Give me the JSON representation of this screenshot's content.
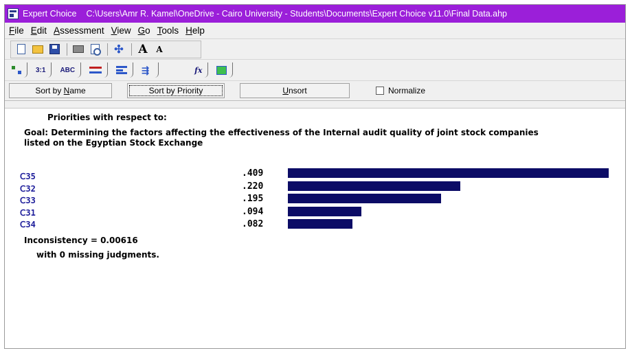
{
  "window": {
    "app_name": "Expert Choice",
    "path": "C:\\Users\\Amr R. Kamel\\OneDrive - Cairo University - Students\\Documents\\Expert Choice v11.0\\Final Data.ahp",
    "accent_color": "#9b1fd9"
  },
  "menu": [
    "File",
    "Edit",
    "Assessment",
    "View",
    "Go",
    "Tools",
    "Help"
  ],
  "toolbar": {
    "icons": [
      "new-file-icon",
      "open-folder-icon",
      "save-icon",
      "print-icon",
      "print-preview-icon",
      "move-icon",
      "font-larger-icon",
      "font-smaller-icon"
    ],
    "font_larger": "A",
    "font_smaller": "A",
    "move_glyph": "✣"
  },
  "mode_tabs": {
    "pairwise_numerical": "3:1",
    "pairwise_verbal": "ABC",
    "formula": "fx"
  },
  "sort_bar": {
    "sort_by_name_prefix": "Sort by ",
    "sort_by_name_acc": "N",
    "sort_by_name_suffix": "ame",
    "sort_by_priority": "Sort by Priority",
    "unsort_acc": "U",
    "unsort_suffix": "nsort",
    "normalize_label": "Normalize",
    "normalize_checked": false
  },
  "results": {
    "heading": "Priorities with respect to:",
    "goal_text": "Goal: Determining the factors affecting the effectiveness of the Internal audit quality of joint stock companies listed on the Egyptian Stock Exchange",
    "bar_color": "#0c0c66",
    "inconsistency": "Inconsistency = 0.00616",
    "missing": "with 0  missing judgments."
  },
  "chart_data": {
    "type": "bar",
    "orientation": "horizontal",
    "categories": [
      "C35",
      "C32",
      "C33",
      "C31",
      "C34"
    ],
    "category_labels": [
      "Ⅽ35",
      "Ⅽ32",
      "Ⅽ33",
      "Ⅽ31",
      "Ⅽ34"
    ],
    "values": [
      0.409,
      0.22,
      0.195,
      0.094,
      0.082
    ],
    "value_labels": [
      ".409",
      ".220",
      ".195",
      ".094",
      ".082"
    ],
    "xlim": [
      0,
      0.409
    ],
    "grid": false
  }
}
